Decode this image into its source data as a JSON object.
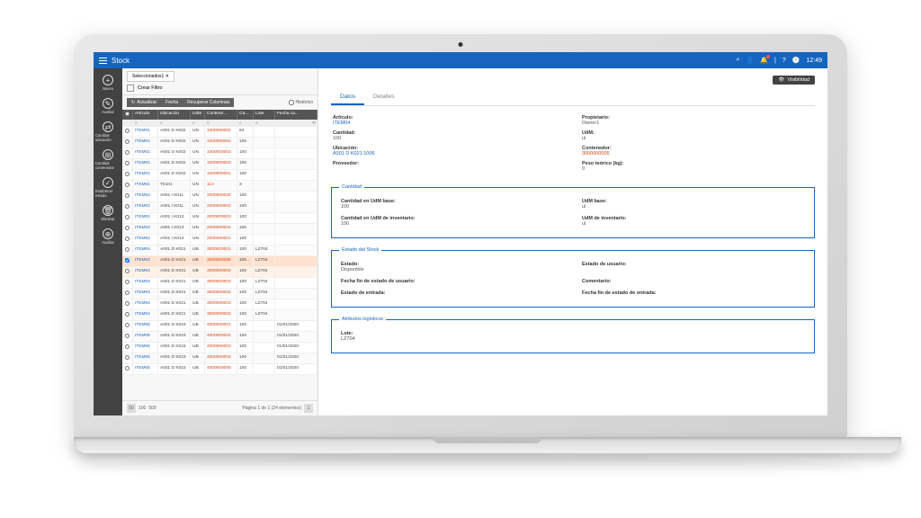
{
  "topbar": {
    "title": "Stock",
    "time": "12:49",
    "notif_count": "2"
  },
  "sidebar": [
    {
      "id": "nuevo",
      "label": "Nuevo",
      "icon": "+"
    },
    {
      "id": "auxiliar",
      "label": "Auxiliar",
      "icon": "✎"
    },
    {
      "id": "cambiar-ubicacion",
      "label": "Cambiar ubicación",
      "icon": "⇄"
    },
    {
      "id": "cambiar-contenedor",
      "label": "Cambiar contenedor",
      "icon": "⊞"
    },
    {
      "id": "establecer-estado",
      "label": "Establecer estado",
      "icon": "✓"
    },
    {
      "id": "eliminar",
      "label": "Eliminar",
      "icon": "🗑"
    },
    {
      "id": "auxiliar2",
      "label": "Auxiliar",
      "icon": "⊕"
    }
  ],
  "filter": {
    "tab": "Seleccionados1 ✕",
    "create": "Crear Filtro"
  },
  "actions": {
    "refresh": "Actualizar",
    "fix": "Fecha",
    "recover": "Recuperar Columnas",
    "historic": "Histórico"
  },
  "columns": {
    "art": "Artículo",
    "ubi": "Ubicación",
    "udm": "UdM",
    "cont": "Contene...",
    "cant": "Cantidad",
    "lote": "Lote",
    "fecha": "Fecha ca..."
  },
  "rows": [
    {
      "art": "ITEM01",
      "ubi": "A001 D K002",
      "udm": "UN",
      "cont": "1000000002",
      "cant": "94",
      "lote": "",
      "fecha": ""
    },
    {
      "art": "ITEM01",
      "ubi": "A001 D K002",
      "udm": "UN",
      "cont": "1000000002",
      "cant": "100",
      "lote": "",
      "fecha": ""
    },
    {
      "art": "ITEM01",
      "ubi": "A001 D K002",
      "udm": "UN",
      "cont": "1000000003",
      "cant": "100",
      "lote": "",
      "fecha": ""
    },
    {
      "art": "ITEM01",
      "ubi": "A001 D K002",
      "udm": "UN",
      "cont": "1000000003",
      "cant": "100",
      "lote": "",
      "fecha": ""
    },
    {
      "art": "ITEM01",
      "ubi": "A001 D K002",
      "udm": "UN",
      "cont": "1000000001",
      "cant": "100",
      "lote": "",
      "fecha": ""
    },
    {
      "art": "ITEM01",
      "ubi": "T0101",
      "udm": "UN",
      "cont": "113",
      "cant": "3",
      "lote": "",
      "fecha": ""
    },
    {
      "art": "ITEM02",
      "ubi": "A001 I K011",
      "udm": "UN",
      "cont": "2000000025",
      "cant": "100",
      "lote": "",
      "fecha": ""
    },
    {
      "art": "ITEM02",
      "ubi": "A001 I K011",
      "udm": "UN",
      "cont": "2000000002",
      "cant": "100",
      "lote": "",
      "fecha": ""
    },
    {
      "art": "ITEM02",
      "ubi": "A001 I K013",
      "udm": "UN",
      "cont": "2000000003",
      "cant": "100",
      "lote": "",
      "fecha": ""
    },
    {
      "art": "ITEM02",
      "ubi": "A001 I K013",
      "udm": "UN",
      "cont": "2000000004",
      "cant": "100",
      "lote": "",
      "fecha": ""
    },
    {
      "art": "ITEM02",
      "ubi": "A001 I K013",
      "udm": "UN",
      "cont": "2000000001",
      "cant": "100",
      "lote": "",
      "fecha": ""
    },
    {
      "art": "ITEM04",
      "ubi": "A001 D K021",
      "udm": "UB",
      "cont": "3000000001",
      "cant": "100",
      "lote": "LZ704",
      "fecha": ""
    },
    {
      "art": "ITEM04",
      "ubi": "A001 D K021",
      "udm": "UB",
      "cont": "3000000005",
      "cant": "100",
      "lote": "LZ704",
      "fecha": "",
      "selected": true
    },
    {
      "art": "ITEM04",
      "ubi": "A001 D K021",
      "udm": "UB",
      "cont": "3000000004",
      "cant": "100",
      "lote": "LZ704",
      "fecha": "",
      "light": true
    },
    {
      "art": "ITEM04",
      "ubi": "A001 D K021",
      "udm": "UB",
      "cont": "3000000003",
      "cant": "100",
      "lote": "LZ704",
      "fecha": ""
    },
    {
      "art": "ITEM04",
      "ubi": "A001 D K021",
      "udm": "UB",
      "cont": "3000000002",
      "cant": "100",
      "lote": "LZ704",
      "fecha": ""
    },
    {
      "art": "ITEM04",
      "ubi": "A001 D K021",
      "udm": "UB",
      "cont": "3000000003",
      "cant": "100",
      "lote": "LZ704",
      "fecha": ""
    },
    {
      "art": "ITEM04",
      "ubi": "A001 D K021",
      "udm": "UB",
      "cont": "3000000002",
      "cant": "100",
      "lote": "LZ704",
      "fecha": ""
    },
    {
      "art": "ITEM05",
      "ubi": "A001 D K023",
      "udm": "UB",
      "cont": "4000000001",
      "cant": "100",
      "lote": "",
      "fecha": "01/01/2020"
    },
    {
      "art": "ITEM05",
      "ubi": "A001 D K023",
      "udm": "UB",
      "cont": "4000000002",
      "cant": "100",
      "lote": "",
      "fecha": "01/01/2020"
    },
    {
      "art": "ITEM05",
      "ubi": "A001 D K023",
      "udm": "UB",
      "cont": "4000000003",
      "cant": "100",
      "lote": "",
      "fecha": "01/01/2020"
    },
    {
      "art": "ITEM05",
      "ubi": "A001 D K023",
      "udm": "UB",
      "cont": "4000000004",
      "cant": "100",
      "lote": "",
      "fecha": "01/01/2020"
    },
    {
      "art": "ITEM05",
      "ubi": "A001 D K023",
      "udm": "UB",
      "cont": "4000000005",
      "cant": "100",
      "lote": "",
      "fecha": "01/01/2020"
    }
  ],
  "pager": {
    "size1": "100",
    "size2": "500",
    "info": "Página 1 de 1 (24 elementos)",
    "page": "1"
  },
  "tabs": {
    "data": "Datos",
    "details": "Detalles"
  },
  "visibility_btn": "Visibilidad",
  "detail": {
    "articulo": {
      "l": "Artículo:",
      "v": "ITEM04"
    },
    "propietario": {
      "l": "Propietario:",
      "v": "Owner1"
    },
    "cantidad": {
      "l": "Cantidad:",
      "v": "100"
    },
    "udm": {
      "l": "UdM:",
      "v": "ul"
    },
    "ubicacion": {
      "l": "Ubicación:",
      "v": "A001 D K021 1006"
    },
    "contenedor": {
      "l": "Contenedor:",
      "v": "3000000005"
    },
    "proveedor": {
      "l": "Proveedor:",
      "v": ""
    },
    "peso": {
      "l": "Peso teórico (kg):",
      "v": "0"
    }
  },
  "grp_cantidad": {
    "legend": "Cantidad",
    "base": {
      "l": "Cantidad en UdM base:",
      "v": "100"
    },
    "udmbase": {
      "l": "UdM base:",
      "v": "ul"
    },
    "inv": {
      "l": "Cantidad en UdM de inventario:",
      "v": "100"
    },
    "udminv": {
      "l": "UdM de inventario:",
      "v": "ul"
    }
  },
  "grp_estado": {
    "legend": "Estado del Stock",
    "estado": {
      "l": "Estado:",
      "v": "Disponible"
    },
    "estadousr": {
      "l": "Estado de usuario:",
      "v": ""
    },
    "fechafinusr": {
      "l": "Fecha fin de estado de usuario:",
      "v": ""
    },
    "comentario": {
      "l": "Comentario:",
      "v": ""
    },
    "estadoent": {
      "l": "Estado de entrada:",
      "v": ""
    },
    "fechafinent": {
      "l": "Fecha fin de estado de entrada:",
      "v": ""
    }
  },
  "grp_attr": {
    "legend": "Atributos logísticos",
    "lote": {
      "l": "Lote:",
      "v": "LZ704"
    }
  }
}
